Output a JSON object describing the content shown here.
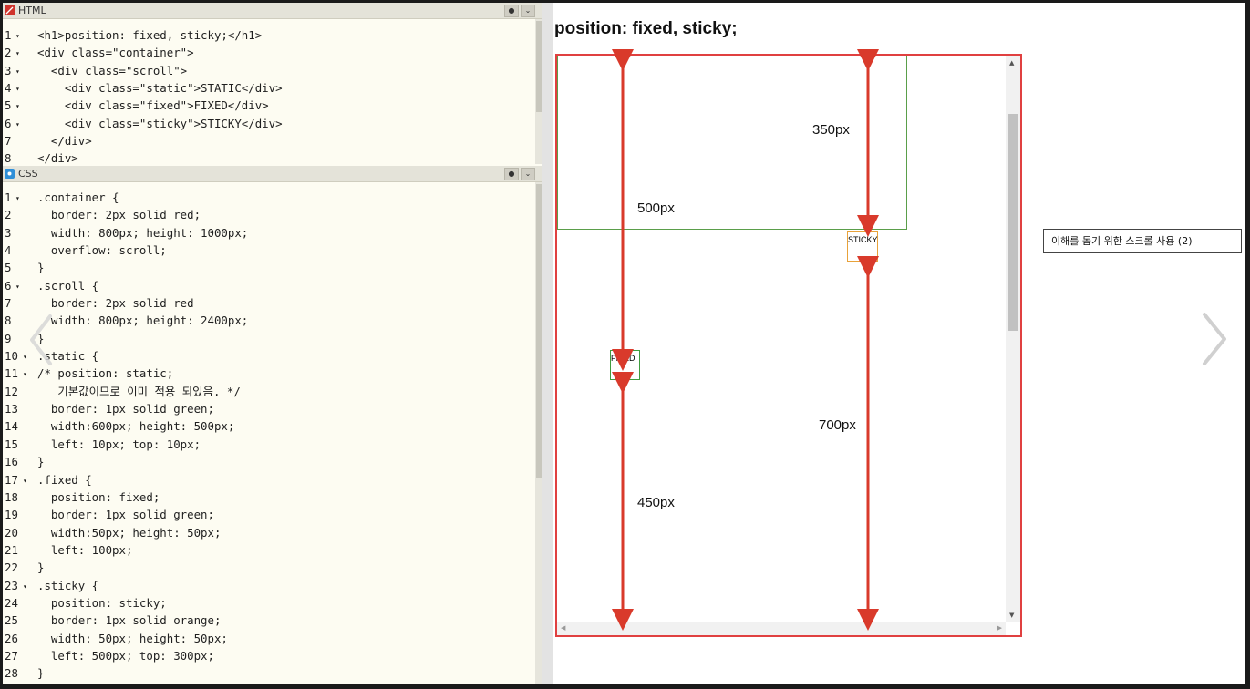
{
  "html_pane": {
    "title": "HTML",
    "lines": [
      {
        "n": "1",
        "fold": true,
        "text": "<h1>position: fixed, sticky;</h1>"
      },
      {
        "n": "2",
        "fold": true,
        "text": "<div class=\"container\">"
      },
      {
        "n": "3",
        "fold": true,
        "text": "  <div class=\"scroll\">"
      },
      {
        "n": "4",
        "fold": true,
        "text": "    <div class=\"static\">STATIC</div>"
      },
      {
        "n": "5",
        "fold": true,
        "text": "    <div class=\"fixed\">FIXED</div>"
      },
      {
        "n": "6",
        "fold": true,
        "text": "    <div class=\"sticky\">STICKY</div>"
      },
      {
        "n": "7",
        "fold": false,
        "text": "  </div>"
      },
      {
        "n": "8",
        "fold": false,
        "text": "</div>"
      }
    ]
  },
  "css_pane": {
    "title": "CSS",
    "lines": [
      {
        "n": "1",
        "fold": true,
        "text": ".container {"
      },
      {
        "n": "2",
        "fold": false,
        "text": "  border: 2px solid red;"
      },
      {
        "n": "3",
        "fold": false,
        "text": "  width: 800px; height: 1000px;"
      },
      {
        "n": "4",
        "fold": false,
        "text": "  overflow: scroll;"
      },
      {
        "n": "5",
        "fold": false,
        "text": "}"
      },
      {
        "n": "6",
        "fold": true,
        "text": ".scroll {"
      },
      {
        "n": "7",
        "fold": false,
        "text": "  border: 2px solid red"
      },
      {
        "n": "8",
        "fold": false,
        "text": "  width: 800px; height: 2400px;"
      },
      {
        "n": "9",
        "fold": false,
        "text": "}"
      },
      {
        "n": "10",
        "fold": true,
        "text": ".static {"
      },
      {
        "n": "11",
        "fold": true,
        "text": "/* position: static;"
      },
      {
        "n": "12",
        "fold": false,
        "text": "   기본값이므로 이미 적용 되있음. */"
      },
      {
        "n": "13",
        "fold": false,
        "text": "  border: 1px solid green;"
      },
      {
        "n": "14",
        "fold": false,
        "text": "  width:600px; height: 500px;"
      },
      {
        "n": "15",
        "fold": false,
        "text": "  left: 10px; top: 10px;"
      },
      {
        "n": "16",
        "fold": false,
        "text": "}"
      },
      {
        "n": "17",
        "fold": true,
        "text": ".fixed {"
      },
      {
        "n": "18",
        "fold": false,
        "text": "  position: fixed;"
      },
      {
        "n": "19",
        "fold": false,
        "text": "  border: 1px solid green;"
      },
      {
        "n": "20",
        "fold": false,
        "text": "  width:50px; height: 50px;"
      },
      {
        "n": "21",
        "fold": false,
        "text": "  left: 100px;"
      },
      {
        "n": "22",
        "fold": false,
        "text": "}"
      },
      {
        "n": "23",
        "fold": true,
        "text": ".sticky {"
      },
      {
        "n": "24",
        "fold": false,
        "text": "  position: sticky;"
      },
      {
        "n": "25",
        "fold": false,
        "text": "  border: 1px solid orange;"
      },
      {
        "n": "26",
        "fold": false,
        "text": "  width: 50px; height: 50px;"
      },
      {
        "n": "27",
        "fold": false,
        "text": "  left: 500px; top: 300px;"
      },
      {
        "n": "28",
        "fold": false,
        "text": "}"
      }
    ]
  },
  "result": {
    "title": "position: fixed, sticky;",
    "fixed_label": "FIXED",
    "sticky_label": "STICKY",
    "measure_500": "500px",
    "measure_350": "350px",
    "measure_700": "700px",
    "measure_450": "450px",
    "note": "이해를 돕기 위한 스크롤 사용 (2)"
  },
  "colors": {
    "html_icon": "#d0342c",
    "css_icon": "#2f8fd8",
    "arrow": "#d93a2b",
    "container_border": "#e04040",
    "static_border": "#5a9e4a",
    "sticky_border": "#e8a23a"
  },
  "icons": {
    "collapse_btn": "gear-icon",
    "expand_btn": "chevron-down-icon",
    "prev": "chevron-left-icon",
    "next": "chevron-right-icon"
  }
}
